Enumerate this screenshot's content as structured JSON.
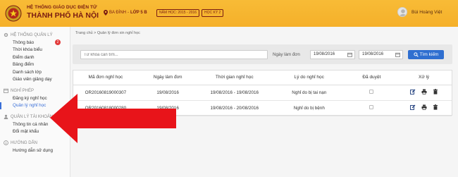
{
  "header": {
    "brand_line1": "HỆ THỐNG GIÁO DỤC ĐIỆN TỬ",
    "brand_line2": "THÀNH PHỐ HÀ NỘI",
    "location_district": "BA ĐÌNH",
    "location_class": "LỚP 5 B",
    "school_year": "NĂM HỌC: 2015 - 2016",
    "term": "HỌC KỲ 2",
    "username": "Bùi Hoàng Việt"
  },
  "sidebar": {
    "sections": [
      {
        "title": "HỆ THỐNG QUẢN LÝ",
        "items": [
          {
            "label": "Thông báo",
            "badge": "2"
          },
          {
            "label": "Thời khóa biểu"
          },
          {
            "label": "Điểm danh"
          },
          {
            "label": "Bảng điểm"
          },
          {
            "label": "Danh sách lớp"
          },
          {
            "label": "Giáo viên giảng dạy"
          }
        ]
      },
      {
        "title": "NGHỈ PHÉP",
        "items": [
          {
            "label": "Đăng ký nghỉ học"
          },
          {
            "label": "Quản lý nghỉ học"
          }
        ]
      },
      {
        "title": "QUẢN LÝ TÀI KHOẢN",
        "items": [
          {
            "label": "Thông tin cá nhân"
          },
          {
            "label": "Đổi mật khẩu"
          }
        ]
      },
      {
        "title": "HƯỚNG DẪN",
        "items": [
          {
            "label": "Hướng dẫn sử dụng"
          }
        ]
      }
    ]
  },
  "breadcrumb": {
    "home": "Trang chủ",
    "sep": ">",
    "current": "Quản lý đơn xin nghỉ học"
  },
  "filter": {
    "keyword_placeholder": "Từ khóa cần tìm...",
    "date_label": "Ngày làm đơn",
    "date_from": "19/08/2016",
    "date_to": "19/08/2016",
    "search_label": "Tìm kiếm"
  },
  "table": {
    "headers": [
      "Mã đơn nghỉ học",
      "Ngày làm đơn",
      "Thời gian nghỉ học",
      "Lý do nghỉ học",
      "Đã duyệt",
      "Xử lý"
    ],
    "rows": [
      {
        "code": "OR20160819000307",
        "date": "19/08/2016",
        "period": "19/08/2016 - 19/08/2016",
        "reason": "Nghỉ do bị tai nạn"
      },
      {
        "code": "OR20160818000280",
        "date": "19/08/2016",
        "period": "19/08/2016 - 20/08/2016",
        "reason": "Nghỉ do bị bệnh"
      }
    ]
  },
  "colors": {
    "header_bg": "#f7b733",
    "brand_text": "#7a1c12",
    "primary_blue": "#2f6fd0",
    "arrow_red": "#e8141a"
  },
  "icons": [
    "logo-emblem",
    "location-pin-icon",
    "user-avatar",
    "calendar-icon",
    "search-icon",
    "edit-icon",
    "print-icon",
    "trash-icon",
    "gear-icon",
    "calendar-section-icon",
    "user-section-icon",
    "info-icon",
    "red-arrow"
  ]
}
